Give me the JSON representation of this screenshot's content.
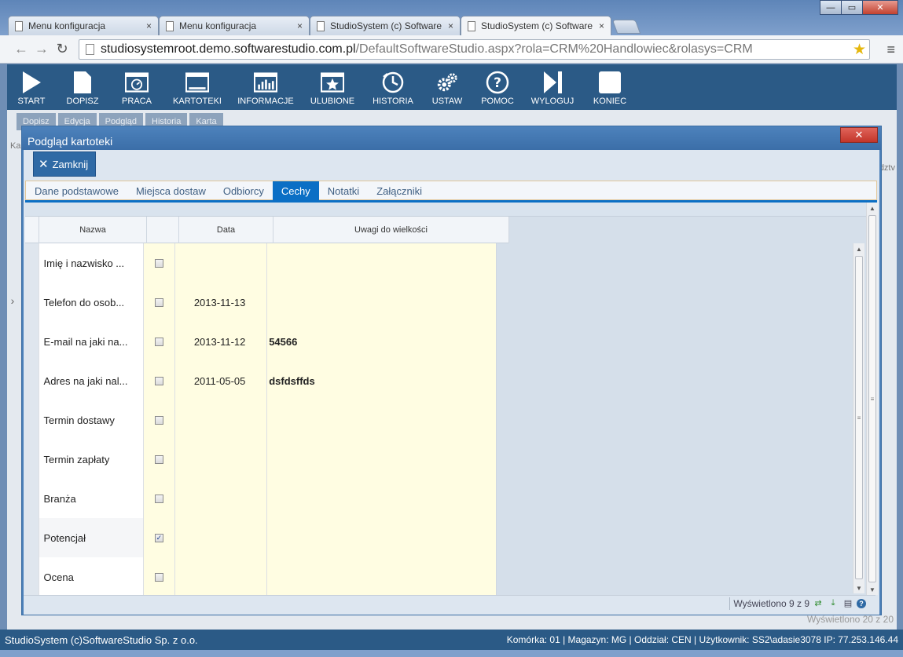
{
  "browser": {
    "tabs": [
      {
        "label": "Menu konfiguracja",
        "close": "×"
      },
      {
        "label": "Menu konfiguracja",
        "close": "×"
      },
      {
        "label": "StudioSystem (c) Software",
        "close": "×"
      },
      {
        "label": "StudioSystem (c) Software",
        "close": "×"
      }
    ],
    "url_host": "studiosystemroot.demo.softwarestudio.com.pl",
    "url_path": "/DefaultSoftwareStudio.aspx?rola=CRM%20Handlowiec&rolasys=CRM",
    "star_icon": "★",
    "menu_icon": "≡",
    "back_icon": "←",
    "forward_icon": "→",
    "reload_icon": "↻",
    "window_controls": {
      "minimize": "—",
      "maximize": "▭",
      "close": "✕"
    }
  },
  "app_nav": [
    {
      "label": "START",
      "icon": "play-icon"
    },
    {
      "label": "DOPISZ",
      "icon": "document-icon"
    },
    {
      "label": "PRACA",
      "icon": "window-clock-icon"
    },
    {
      "label": "KARTOTEKI",
      "icon": "window-icon"
    },
    {
      "label": "INFORMACJE",
      "icon": "chart-icon"
    },
    {
      "label": "ULUBIONE",
      "icon": "star-icon"
    },
    {
      "label": "HISTORIA",
      "icon": "history-icon"
    },
    {
      "label": "USTAW",
      "icon": "gears-icon"
    },
    {
      "label": "POMOC",
      "icon": "help-icon"
    },
    {
      "label": "WYLOGUJ",
      "icon": "logout-icon"
    },
    {
      "label": "KONIEC",
      "icon": "stop-icon"
    }
  ],
  "background": {
    "buttons": [
      "Dopisz",
      "Edycja",
      "Podgląd",
      "Historia",
      "Karta"
    ],
    "status_text": "Wyświetlono 20 z 20",
    "left_label": "Ka",
    "right_label": "dztv"
  },
  "modal": {
    "title": "Podgląd kartoteki",
    "close_icon": "✕",
    "close_button_label": "Zamknij",
    "tabs": [
      {
        "label": "Dane podstawowe",
        "active": false
      },
      {
        "label": "Miejsca dostaw",
        "active": false
      },
      {
        "label": "Odbiorcy",
        "active": false
      },
      {
        "label": "Cechy",
        "active": true
      },
      {
        "label": "Notatki",
        "active": false
      },
      {
        "label": "Załączniki",
        "active": false
      }
    ],
    "grid": {
      "headers": {
        "nazwa": "Nazwa",
        "check": "",
        "data": "Data",
        "uwagi": "Uwagi do wielkości"
      },
      "rows": [
        {
          "nazwa": "Imię i nazwisko ...",
          "checked": false,
          "data": "",
          "uwagi": ""
        },
        {
          "nazwa": "Telefon do osob...",
          "checked": false,
          "data": "2013-11-13",
          "uwagi": ""
        },
        {
          "nazwa": "E-mail na jaki na...",
          "checked": false,
          "data": "2013-11-12",
          "uwagi": "54566"
        },
        {
          "nazwa": "Adres na jaki nal...",
          "checked": false,
          "data": "2011-05-05",
          "uwagi": "dsfdsffds"
        },
        {
          "nazwa": "Termin dostawy",
          "checked": false,
          "data": "",
          "uwagi": ""
        },
        {
          "nazwa": "Termin zapłaty",
          "checked": false,
          "data": "",
          "uwagi": ""
        },
        {
          "nazwa": "Branża",
          "checked": false,
          "data": "",
          "uwagi": ""
        },
        {
          "nazwa": "Potencjał",
          "checked": true,
          "data": "",
          "uwagi": ""
        },
        {
          "nazwa": "Ocena",
          "checked": false,
          "data": "",
          "uwagi": ""
        }
      ],
      "footer_text": "Wyświetlono 9 z 9",
      "check_mark": "✓"
    }
  },
  "status_bar": {
    "left": "StudioSystem (c)SoftwareStudio Sp. z o.o.",
    "right": "Komórka: 01 | Magazyn: MG | Oddział: CEN | Użytkownik: SS2\\adasie3078 IP: 77.253.146.44"
  },
  "colors": {
    "nav_bg": "#2b5a86",
    "modal_title": "#3b6ea8",
    "active_tab": "#0b6fc5",
    "cell_yellow": "#fffde2"
  }
}
